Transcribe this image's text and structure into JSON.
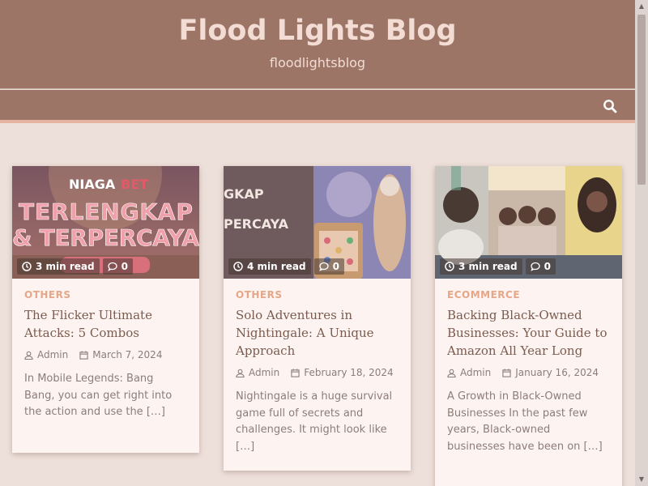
{
  "site": {
    "title": "Flood Lights Blog",
    "description": "floodlightsblog"
  },
  "nav": {
    "search_icon": "search-icon"
  },
  "posts": [
    {
      "read_time": "3 min read",
      "comments": "0",
      "category": "OTHERS",
      "title": "The Flicker Ultimate Attacks: 5 Combos",
      "author": "Admin",
      "date": "March 7, 2024",
      "excerpt": "In Mobile Legends: Bang Bang, you can get right into the action and use the […]",
      "thumb_text_1": "NIAGA",
      "thumb_text_2": "TERLENGKAP",
      "thumb_text_3": "& TERPERCAYA"
    },
    {
      "read_time": "4 min read",
      "comments": "0",
      "category": "OTHERS",
      "title": "Solo Adventures in Nightingale: A Unique Approach",
      "author": "Admin",
      "date": "February 18, 2024",
      "excerpt": "Nightingale is a huge survival game full of secrets and challenges. It might look like […]",
      "thumb_text_1": "GKAP",
      "thumb_text_2": "PERCAYA"
    },
    {
      "read_time": "3 min read",
      "comments": "0",
      "category": "ECOMMERCE",
      "title": "Backing Black-Owned Businesses: Your Guide to Amazon All Year Long",
      "author": "Admin",
      "date": "January 16, 2024",
      "excerpt": "A Growth in Black-Owned Businesses In the past few years, Black-owned businesses have been on […]"
    }
  ],
  "colors": {
    "header": "#9c7567",
    "accent": "#e6a688",
    "background": "#eddfd9"
  }
}
